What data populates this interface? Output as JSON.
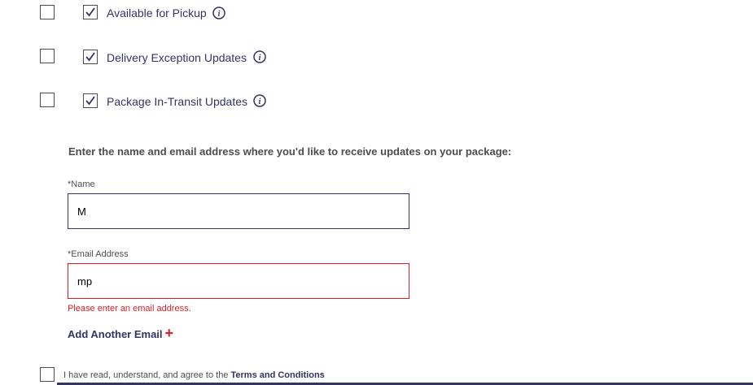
{
  "options": [
    {
      "label": "Available for Pickup",
      "left_checked": false,
      "right_checked": true
    },
    {
      "label": "Delivery Exception Updates",
      "left_checked": false,
      "right_checked": true
    },
    {
      "label": "Package In-Transit Updates",
      "left_checked": false,
      "right_checked": true
    }
  ],
  "form": {
    "instruction": "Enter the name and email address where you'd like to receive updates on your package:",
    "name_label": "*Name",
    "name_value": "M",
    "email_label": "*Email Address",
    "email_value": "mp",
    "email_error": "Please enter an email address.",
    "add_email_label": "Add Another Email",
    "add_email_icon": "+"
  },
  "terms": {
    "text": "I have read, understand, and agree to the ",
    "link": "Terms and Conditions"
  },
  "colors": {
    "navy": "#333366",
    "error_red": "#e71921"
  }
}
